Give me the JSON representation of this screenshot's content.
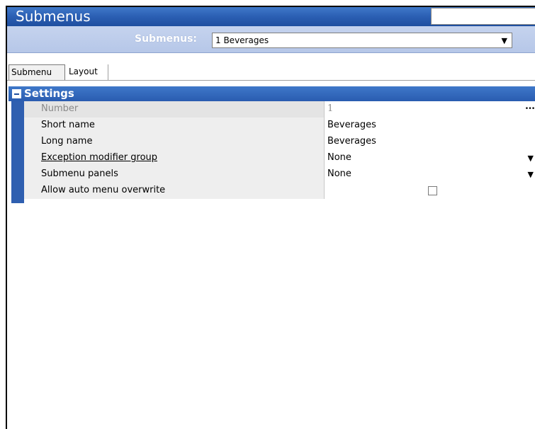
{
  "window": {
    "title": "Submenus"
  },
  "selector": {
    "label": "Submenus:",
    "value": "1 Beverages"
  },
  "tabs": [
    {
      "label": "Submenu",
      "active": true
    },
    {
      "label": "Layout",
      "active": false
    }
  ],
  "settings": {
    "section_title": "Settings",
    "rows": [
      {
        "label": "Number",
        "value": "1",
        "control": "ellipsis",
        "disabled": true
      },
      {
        "label": "Short name",
        "value": "Beverages",
        "control": "text"
      },
      {
        "label": "Long name",
        "value": "Beverages",
        "control": "text"
      },
      {
        "label": "Exception modifier group",
        "value": "None",
        "control": "dropdown",
        "link": true
      },
      {
        "label": "Submenu panels",
        "value": "None",
        "control": "dropdown"
      },
      {
        "label": "Allow auto menu overwrite",
        "checked": false,
        "control": "checkbox"
      }
    ]
  },
  "icons": {
    "collapse": "collapse-minus-icon",
    "dropdown": "chevron-down-icon",
    "ellipsis": "ellipsis-icon"
  },
  "colors": {
    "header_blue": "#2b5fb3",
    "selector_bg": "#b6c7e8",
    "label_bg": "#eeeeee"
  }
}
